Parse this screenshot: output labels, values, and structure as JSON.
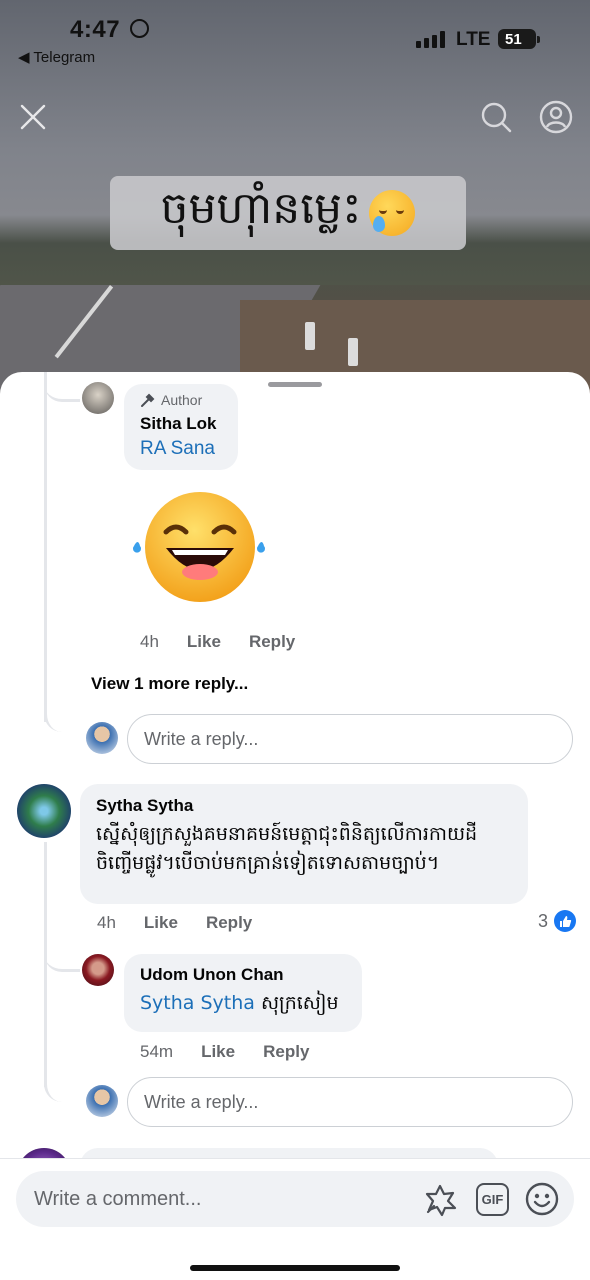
{
  "status_bar": {
    "time": "4:47",
    "back_app": "◀ Telegram",
    "network": "LTE",
    "battery": "51"
  },
  "video": {
    "caption": "ចុមហ៊ាំនម្លេះ"
  },
  "author_reply": {
    "badge": "Author",
    "name": "Sitha Lok",
    "mention": "RA Sana",
    "time": "4h",
    "like": "Like",
    "reply": "Reply"
  },
  "view_more": "View 1 more reply...",
  "reply_placeholder": "Write a reply...",
  "comment": {
    "name": "Sytha Sytha",
    "text_line1": "ស្នើសុំឲ្យក្រសួងគមនាគមន៍មេត្តាជុះពិនិត្យលើការកាយដី",
    "text_line2": "ចិញ្ចើមផ្លូវ។បើចាប់មកគ្រាន់ទៀតទោសតាមច្បាប់។",
    "time": "4h",
    "like": "Like",
    "reply": "Reply",
    "like_count": "3"
  },
  "nested_reply": {
    "name": "Udom Unon Chan",
    "mention": "Sytha Sytha",
    "text": " សុក្រសៀម",
    "time": "54m",
    "like": "Like",
    "reply": "Reply"
  },
  "composer": {
    "placeholder": "Write a comment...",
    "gif": "GIF"
  },
  "colors": {
    "mention": "#1c6fb8",
    "like_badge": "#1877f2",
    "bubble": "#f0f2f5"
  }
}
